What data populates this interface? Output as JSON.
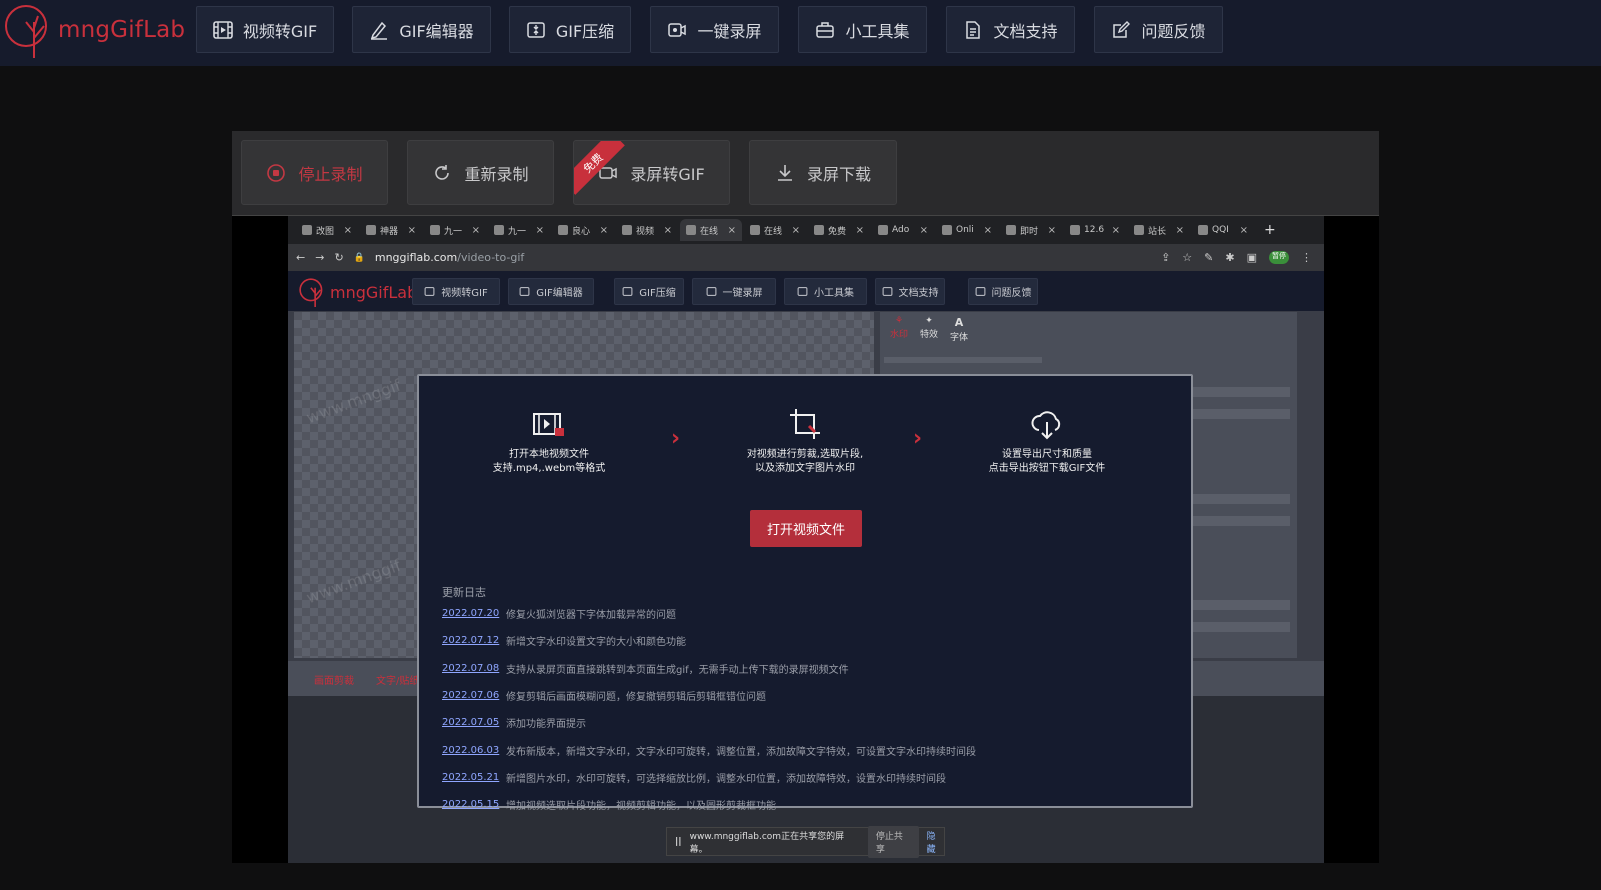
{
  "app": {
    "logo_text": "mngGifLab",
    "brand_color": "#c9303c"
  },
  "nav": {
    "items": [
      {
        "label": "视频转GIF",
        "icon": "film-icon"
      },
      {
        "label": "GIF编辑器",
        "icon": "pen-icon"
      },
      {
        "label": "GIF压缩",
        "icon": "compress-icon"
      },
      {
        "label": "一键录屏",
        "icon": "record-icon"
      },
      {
        "label": "小工具集",
        "icon": "toolbox-icon"
      },
      {
        "label": "文档支持",
        "icon": "document-icon"
      },
      {
        "label": "问题反馈",
        "icon": "feedback-icon"
      }
    ]
  },
  "recorder": {
    "stop": "停止录制",
    "restart": "重新录制",
    "to_gif": "录屏转GIF",
    "ribbon": "免费",
    "download": "录屏下载"
  },
  "browser": {
    "tabs": [
      "改图",
      "神器",
      "九一",
      "九一",
      "良心",
      "视频",
      "在线",
      "在线",
      "免费",
      "Ado",
      "Onli",
      "即时",
      "12.6",
      "站长",
      "QQI"
    ],
    "active_tab_index": 6,
    "url_host": "mnggiflab.com",
    "url_path": "/video-to-gif",
    "profile_badge": "暂停"
  },
  "inner": {
    "logo_text": "mngGifLab",
    "nav": [
      "视频转GIF",
      "GIF编辑器",
      "GIF压缩",
      "一键录屏",
      "小工具集",
      "文档支持",
      "问题反馈"
    ],
    "watermark": "www.mnggif",
    "right_tabs": [
      "水印",
      "特效",
      "字体"
    ],
    "bottom_tabs": [
      "画面剪裁",
      "文字/贴纸"
    ]
  },
  "modal": {
    "step1_line1": "打开本地视频文件",
    "step1_line2": "支持.mp4,.webm等格式",
    "step2_line1": "对视频进行剪裁,选取片段,",
    "step2_line2": "以及添加文字图片水印",
    "step3_line1": "设置导出尺寸和质量",
    "step3_line2": "点击导出按钮下载GIF文件",
    "open_button": "打开视频文件",
    "log_title": "更新日志",
    "log": [
      {
        "date": "2022.07.20",
        "text": "修复火狐浏览器下字体加载异常的问题"
      },
      {
        "date": "2022.07.12",
        "text": "新增文字水印设置文字的大小和颜色功能"
      },
      {
        "date": "2022.07.08",
        "text": "支持从录屏页面直接跳转到本页面生成gif，无需手动上传下载的录屏视频文件"
      },
      {
        "date": "2022.07.06",
        "text": "修复剪辑后画面模糊问题，修复撤销剪辑后剪辑框错位问题"
      },
      {
        "date": "2022.07.05",
        "text": "添加功能界面提示"
      },
      {
        "date": "2022.06.03",
        "text": "发布新版本，新增文字水印，文字水印可旋转，调整位置，添加故障文字特效，可设置文字水印持续时间段"
      },
      {
        "date": "2022.05.21",
        "text": "新增图片水印，水印可旋转，可选择缩放比例，调整水印位置，添加故障特效，设置水印持续时间段"
      },
      {
        "date": "2022.05.15",
        "text": "增加视频选取片段功能，视频剪辑功能，以及圆形剪裁框功能"
      }
    ]
  },
  "share_bar": {
    "pause_icon": "||",
    "text": "www.mnggiflab.com正在共享您的屏幕。",
    "stop": "停止共享",
    "hide": "隐藏"
  }
}
